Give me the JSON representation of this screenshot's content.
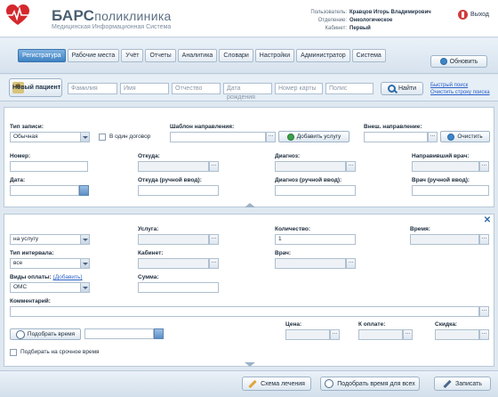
{
  "header": {
    "brand_main": "БАРС",
    "brand_thin": "поликлиника",
    "subtitle": "Медицинская Информационная Система",
    "user": [
      {
        "key": "Пользователь:",
        "value": "Кравцов Игорь Владимирович"
      },
      {
        "key": "Отделение:",
        "value": "Онкологическое"
      },
      {
        "key": "Кабинет:",
        "value": "Первый"
      }
    ],
    "exit_label": "Выход",
    "brand_color": "#d4282e"
  },
  "nav": {
    "tabs": [
      "Регистратура",
      "Рабочие места",
      "Учёт",
      "Отчеты",
      "Аналитика",
      "Словари",
      "Настройки",
      "Администратор",
      "Система"
    ],
    "active_index": 0,
    "refresh_label": "Обновить"
  },
  "search": {
    "new_patient_label": "Новый пациент",
    "fields": [
      "Фамилия",
      "Имя",
      "Отчество",
      "Дата рождения",
      "Номер карты",
      "Полис"
    ],
    "find_label": "Найти",
    "quick_search": "Быстрый поиск",
    "clear_search": "Очистить строку поиска"
  },
  "referral": {
    "record_type_label": "Тип записи:",
    "record_type_value": "Обычная",
    "one_contract_label": "В один договор",
    "template_label": "Шаблон направления:",
    "add_service_label": "Добавить услугу",
    "external_label": "Внеш. направление:",
    "clear_label": "Очистить",
    "number_label": "Номер:",
    "from_label": "Откуда:",
    "diagnosis_label": "Диагноз:",
    "referring_doctor_label": "Направивший врач:",
    "date_label": "Дата:",
    "from_manual_label": "Откуда (ручной ввод):",
    "diagnosis_manual_label": "Диагноз (ручной ввод):",
    "doctor_manual_label": "Врач (ручной ввод):"
  },
  "service": {
    "type_value": "на услугу",
    "service_label": "Услуга:",
    "quantity_label": "Количество:",
    "quantity_value": "1",
    "time_label": "Время:",
    "interval_type_label": "Тип интервала:",
    "interval_type_value": "все",
    "cabinet_label": "Кабинет:",
    "doctor_label": "Врач:",
    "payment_label": "Виды оплаты:",
    "payment_add_link": "(Добавить)",
    "payment_value": "ОМС",
    "sum_label": "Сумма:",
    "comment_label": "Комментарий:",
    "pick_time_label": "Подобрать время",
    "price_label": "Цена:",
    "to_pay_label": "К оплате:",
    "discount_label": "Скидка:",
    "urgent_label": "Подбирать на срочное время"
  },
  "footer": {
    "treatment_scheme": "Схема лечения",
    "pick_time_all": "Подобрать время для всех",
    "save": "Записать"
  }
}
